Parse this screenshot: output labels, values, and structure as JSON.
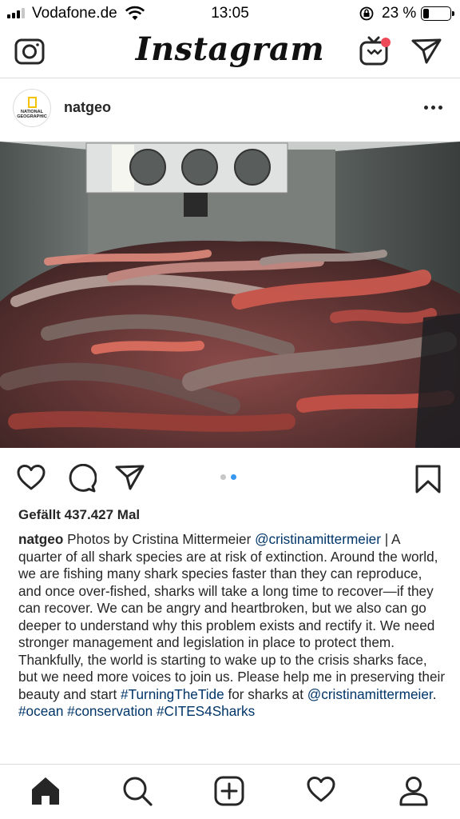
{
  "status_bar": {
    "carrier": "Vodafone.de",
    "time": "13:05",
    "battery_pct": "23 %",
    "battery_level": 0.23
  },
  "top_nav": {
    "logo": "Instagram",
    "icons": [
      "camera-icon",
      "igtv-icon",
      "direct-message-icon"
    ]
  },
  "post": {
    "username": "natgeo",
    "avatar_text": "NATIONAL GEOGRAPHIC",
    "image_description_icon": "post-photo",
    "carousel": {
      "count": 2,
      "active": 1,
      "active_color": "#3897f0",
      "inactive_color": "#c7c7c7"
    },
    "likes": "Gefällt 437.427 Mal",
    "caption": {
      "username": "natgeo",
      "text_1": " Photos by Cristina Mittermeier ",
      "mention_1": "@cristinamittermeier",
      "text_2": " | A quarter of all shark species are at risk of extinction. Around the world, we are fishing many shark species faster than they can reproduce, and once over-fished, sharks will take a long time to recover—if they can recover. We can be angry and heartbroken, but we also can go deeper to understand why this problem exists and rectify it. We need stronger management and legislation in place to protect them. Thankfully, the world is starting to wake up to the crisis sharks face, but we need more voices to join us. Please help me in preserving their beauty and start ",
      "hashtag_1": "#TurningTheTide",
      "text_3": " for sharks at ",
      "mention_2": "@cristinamittermeier",
      "text_4": ". ",
      "hashtag_2": "#ocean",
      "text_5": " ",
      "hashtag_3": "#conservation",
      "text_6": " ",
      "hashtag_4": "#CITES4Sharks"
    }
  },
  "colors": {
    "link": "#003569",
    "text": "#262626",
    "notification": "#ed4956"
  },
  "tab_bar": {
    "items": [
      "home-icon",
      "search-icon",
      "new-post-icon",
      "activity-icon",
      "profile-icon"
    ],
    "active": "home-icon"
  }
}
